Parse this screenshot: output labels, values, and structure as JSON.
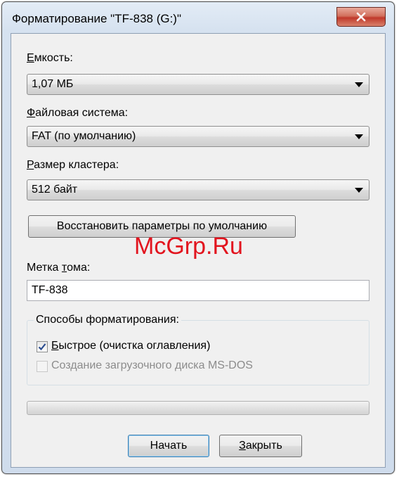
{
  "window": {
    "title": "Форматирование \"TF-838 (G:)\"",
    "close_icon": "close-icon"
  },
  "capacity": {
    "label_hot": "Е",
    "label_rest": "мкость:",
    "value": "1,07 МБ"
  },
  "filesystem": {
    "label_hot": "Ф",
    "label_rest": "айловая система:",
    "value": "FAT (по умолчанию)"
  },
  "cluster": {
    "label_hot": "Р",
    "label_rest": "азмер кластера:",
    "value": "512 байт"
  },
  "restore_button": "Восстановить параметры по умолчанию",
  "volume_label": {
    "label_pre": "Метка ",
    "label_hot": "т",
    "label_rest": "ома:",
    "value": "TF-838"
  },
  "format_options": {
    "title": "Способы форматирования:",
    "quick": {
      "label_hot": "Б",
      "label_rest": "ыстрое (очистка оглавления)",
      "checked": true,
      "enabled": true
    },
    "msdos": {
      "label": "Создание загрузочного диска MS-DOS",
      "checked": false,
      "enabled": false
    }
  },
  "progress": {
    "value": 0
  },
  "buttons": {
    "start": "Начать",
    "close_hot": "З",
    "close_rest": "акрыть"
  },
  "watermark": "McGrp.Ru",
  "colors": {
    "close_button": "#c0392b",
    "watermark": "#e2141e",
    "progress_fill": "#06b025"
  }
}
